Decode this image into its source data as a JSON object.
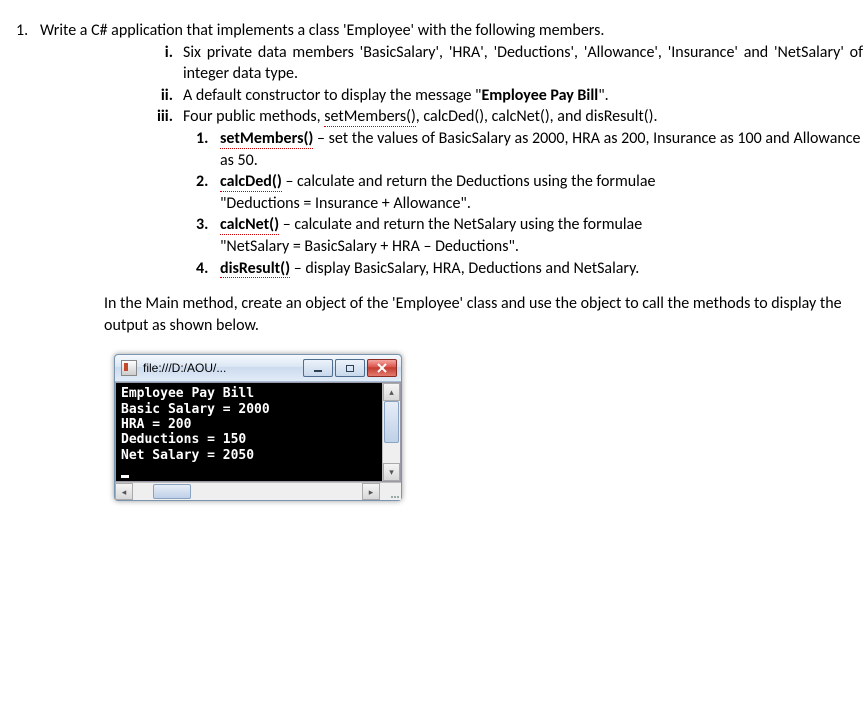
{
  "q": {
    "num": "1.",
    "intro": "Write a C# application that implements a class 'Employee' with the following members."
  },
  "items": {
    "i": {
      "label": "i.",
      "text": "Six private data members 'BasicSalary', 'HRA', 'Deductions', 'Allowance', 'Insurance' and 'NetSalary' of integer data type."
    },
    "ii": {
      "label": "ii.",
      "pre": "A default constructor to display the message \"",
      "bold": "Employee Pay Bill",
      "post": "\"."
    },
    "iii": {
      "label": "iii.",
      "pre": "Four public methods, ",
      "u": "setMembers()",
      "post": ", calcDed(), calcNet(), and disResult()."
    }
  },
  "subs": {
    "s1": {
      "n": "1.",
      "u": "setMembers()",
      "rest": " – set the  values of BasicSalary as 2000, HRA as 200, Insurance as 100 and Allowance as 50."
    },
    "s2": {
      "n": "2.",
      "u": "calcDed()",
      "rest": " – calculate and return the Deductions using the formulae",
      "line2": "\"Deductions = Insurance + Allowance\"."
    },
    "s3": {
      "n": "3.",
      "u": "calcNet()",
      "rest": " – calculate and return the NetSalary using the formulae",
      "line2": "\"NetSalary = BasicSalary + HRA – Deductions\"."
    },
    "s4": {
      "n": "4.",
      "u": "disResult()",
      "rest": " – display BasicSalary, HRA, Deductions and NetSalary."
    }
  },
  "followup": "In the Main method, create an object of the 'Employee' class and use the object to call the methods to display the output as shown below.",
  "console": {
    "title": "file:///D:/AOU/...",
    "lines": {
      "l1": "Employee Pay Bill",
      "l2": "Basic Salary = 2000",
      "l3": "HRA = 200",
      "l4": "Deductions = 150",
      "l5": "Net Salary = 2050"
    }
  }
}
